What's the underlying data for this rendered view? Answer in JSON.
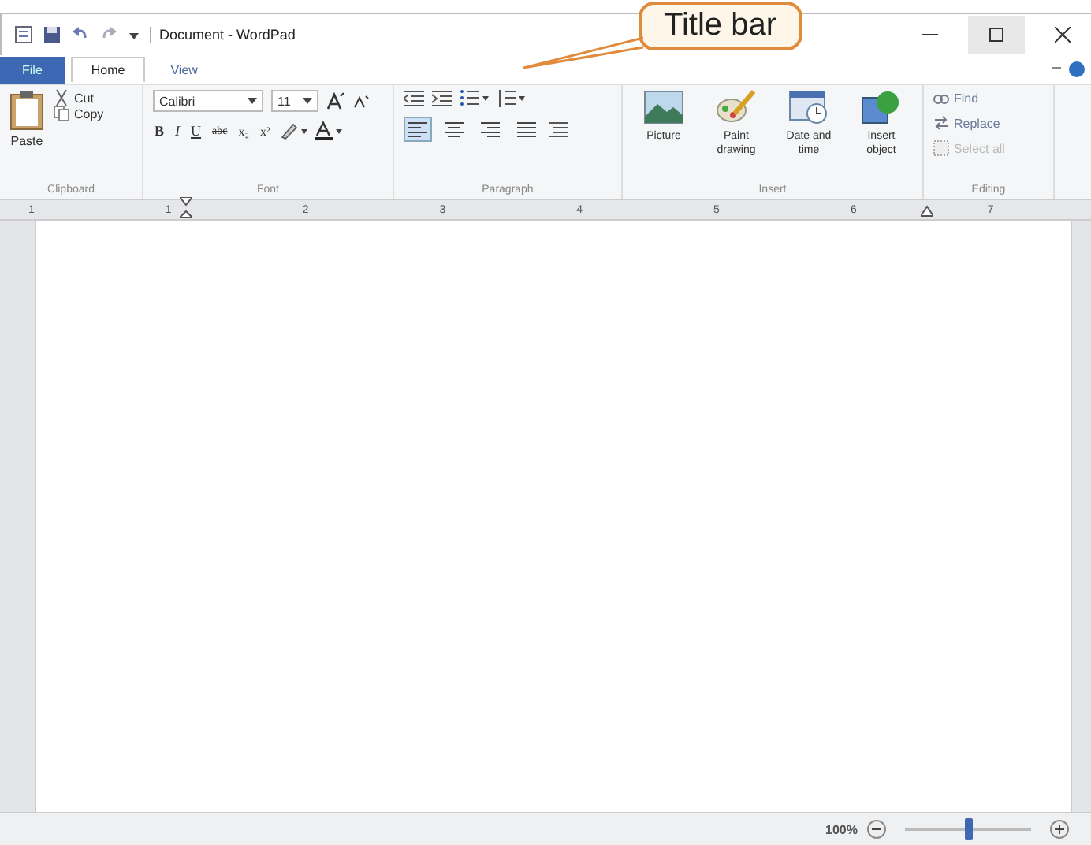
{
  "window": {
    "title": "Document - WordPad"
  },
  "callout": {
    "text": "Title bar"
  },
  "tabs": [
    {
      "label": "File",
      "kind": "app",
      "selected": false
    },
    {
      "label": "Home",
      "kind": "tab",
      "selected": true
    },
    {
      "label": "View",
      "kind": "tab",
      "selected": false
    }
  ],
  "ribbon": {
    "clipboard": {
      "label": "Clipboard",
      "paste": "Paste",
      "cut": "Cut",
      "copy": "Copy"
    },
    "font": {
      "label": "Font",
      "family": "Calibri",
      "size": "11",
      "format_buttons": [
        {
          "kind": "bold",
          "label": "B"
        },
        {
          "kind": "italic",
          "label": "I"
        },
        {
          "kind": "underline",
          "label": "U"
        },
        {
          "kind": "strike",
          "label": "abc"
        },
        {
          "kind": "sub",
          "label": "x₂"
        },
        {
          "kind": "super",
          "label": "x²"
        }
      ]
    },
    "paragraph": {
      "label": "Paragraph",
      "align_buttons": [
        {
          "kind": "left",
          "selected": true
        },
        {
          "kind": "center",
          "selected": false
        },
        {
          "kind": "right",
          "selected": false
        },
        {
          "kind": "justify",
          "selected": false
        }
      ]
    },
    "insert": {
      "label": "Insert",
      "buttons": [
        {
          "kind": "picture",
          "lines": [
            "Picture"
          ]
        },
        {
          "kind": "paint",
          "lines": [
            "Paint",
            "drawing"
          ]
        },
        {
          "kind": "datetime",
          "lines": [
            "Date and",
            "time"
          ]
        },
        {
          "kind": "object",
          "lines": [
            "Insert",
            "object"
          ]
        }
      ]
    },
    "editing": {
      "label": "Editing",
      "items": [
        {
          "kind": "find",
          "label": "Find",
          "disabled": false
        },
        {
          "kind": "replace",
          "label": "Replace",
          "disabled": false
        },
        {
          "kind": "selectall",
          "label": "Select all",
          "disabled": true
        }
      ]
    }
  },
  "ruler": {
    "numbers": [
      "1",
      "1",
      "2",
      "3",
      "4",
      "5",
      "6",
      "7"
    ]
  },
  "status_bar": {
    "zoom": "100%",
    "zoom_slider": {
      "level": 0.5
    }
  }
}
